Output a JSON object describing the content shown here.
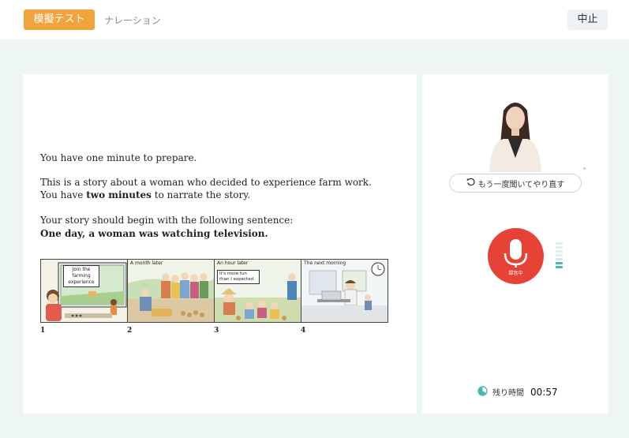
{
  "header": {
    "mode_label": "模擬テスト",
    "section_tab": "ナレーション",
    "stop_label": "中止"
  },
  "prompt": {
    "prep": "You have one minute to prepare.",
    "story_line": "This is a story about a woman who decided to experience farm work.",
    "time_prefix": "You have ",
    "time_bold": "two minutes",
    "time_suffix": " to narrate the story.",
    "begin_line": "Your story should begin with the following sentence:",
    "first_sentence": "One day, a woman was watching television."
  },
  "comic": {
    "panels": [
      {
        "number": "1",
        "caption": "",
        "sign": "Join the farming experience"
      },
      {
        "number": "2",
        "caption": "A month later"
      },
      {
        "number": "3",
        "caption": "An hour later",
        "bubble": "It's more fun than I expected."
      },
      {
        "number": "4",
        "caption": "The next morning"
      }
    ]
  },
  "recorder": {
    "replay_label": "もう一度聞いてやり直す",
    "mic_status": "録音中",
    "remaining_label": "残り時間",
    "remaining_time": "00:57",
    "accent_color": "#e74236",
    "level_color": "#4db8b0",
    "icons": [
      "replay-icon",
      "microphone-icon",
      "timer-icon"
    ]
  }
}
